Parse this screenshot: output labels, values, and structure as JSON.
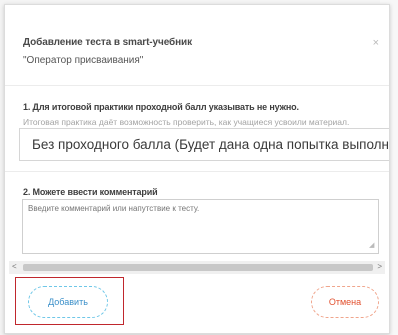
{
  "dialog": {
    "title": "Добавление теста в smart-учебник",
    "subtitle": "\"Оператор присваивания\"",
    "close_glyph": "×",
    "question1": "1. Для итоговой практики проходной балл указывать не нужно.",
    "question1_hint": "Итоговая практика даёт возможность проверить, как учащиеся усвоили материал.",
    "selected_option": "Без проходного балла (Будет дана одна попытка выполнить тест)",
    "question2": "2. Можете ввести комментарий",
    "comment_placeholder": "Введите комментарий или напутствие к тесту.",
    "add_button": "Добавить",
    "cancel_button": "Отмена"
  }
}
